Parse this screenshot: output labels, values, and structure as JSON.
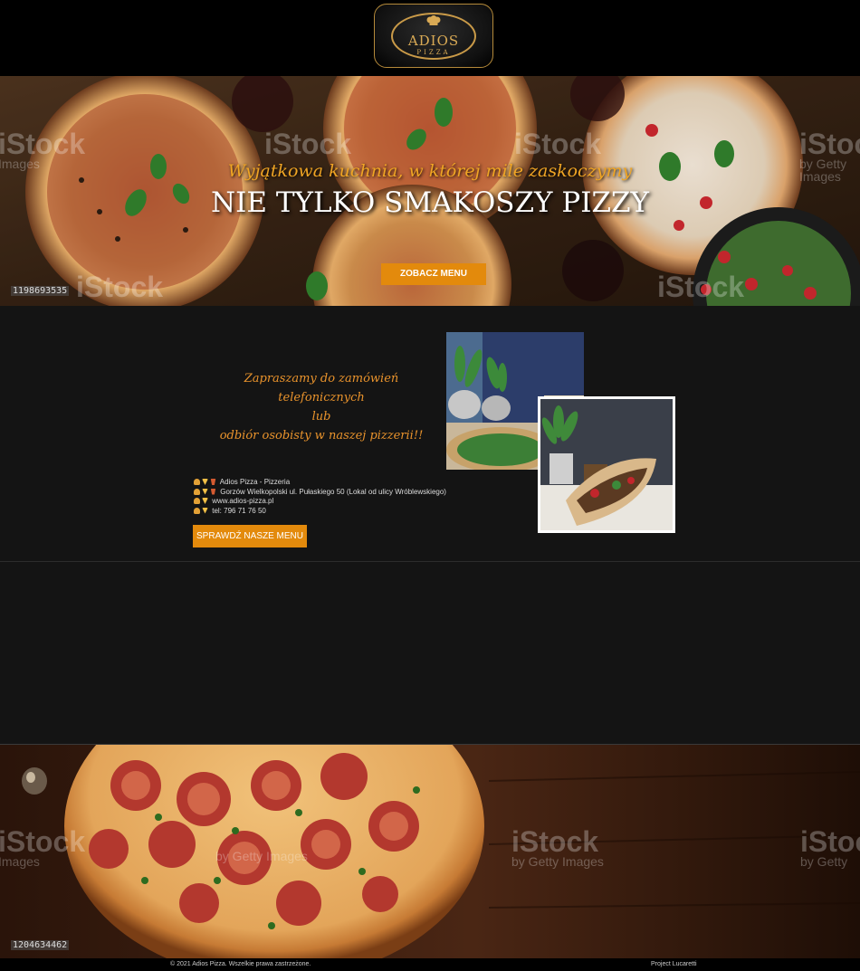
{
  "header": {
    "logo_name": "ADIOS",
    "logo_sub": "PIZZA"
  },
  "hero": {
    "tagline": "Wyjątkowa kuchnia, w której mile zaskoczymy",
    "title": "NIE TYLKO SMAKOSZY PIZZY",
    "button_label": "ZOBACZ MENU",
    "stock_id": "1198693535",
    "watermark_brand": "iStock",
    "watermark_sub": "by Getty Images",
    "watermark_sub_short": "Images"
  },
  "info": {
    "invite_lines": [
      "Zapraszamy do zamówień telefonicznych",
      "lub",
      "odbiór osobisty w naszej pizzerii!!"
    ],
    "details": [
      {
        "icons": [
          "burger-emoji-icon",
          "pizza-emoji-icon",
          "drink-emoji-icon"
        ],
        "text": "Adios Pizza - Pizzeria"
      },
      {
        "icons": [
          "burger-emoji-icon",
          "pizza-emoji-icon",
          "drink-emoji-icon"
        ],
        "text": "Gorzów Wielkopolski ul. Pułaskiego 50 (Lokal od ulicy Wróblewskiego)"
      },
      {
        "icons": [
          "burger-emoji-icon",
          "pizza-emoji-icon"
        ],
        "text": "www.adios-pizza.pl"
      },
      {
        "icons": [
          "burger-emoji-icon",
          "pizza-emoji-icon"
        ],
        "text": "tel: 796 71 76 50"
      }
    ],
    "button_label": "SPRAWDŹ NASZE MENU"
  },
  "bottom_banner": {
    "stock_id": "1204634462",
    "watermark_brand": "iStock",
    "watermark_sub": "by Getty Images",
    "watermark_sub_short": "Images",
    "watermark_sub_right": "by Getty"
  },
  "footer": {
    "copyright": "© 2021 Adios Pizza. Wszelkie prawa zastrzeżone.",
    "project": "Project Lucaretti"
  },
  "colors": {
    "accent": "#e38a0c",
    "gold": "#d9aa55",
    "invite": "#e9932c",
    "section_bg": "#141414"
  }
}
